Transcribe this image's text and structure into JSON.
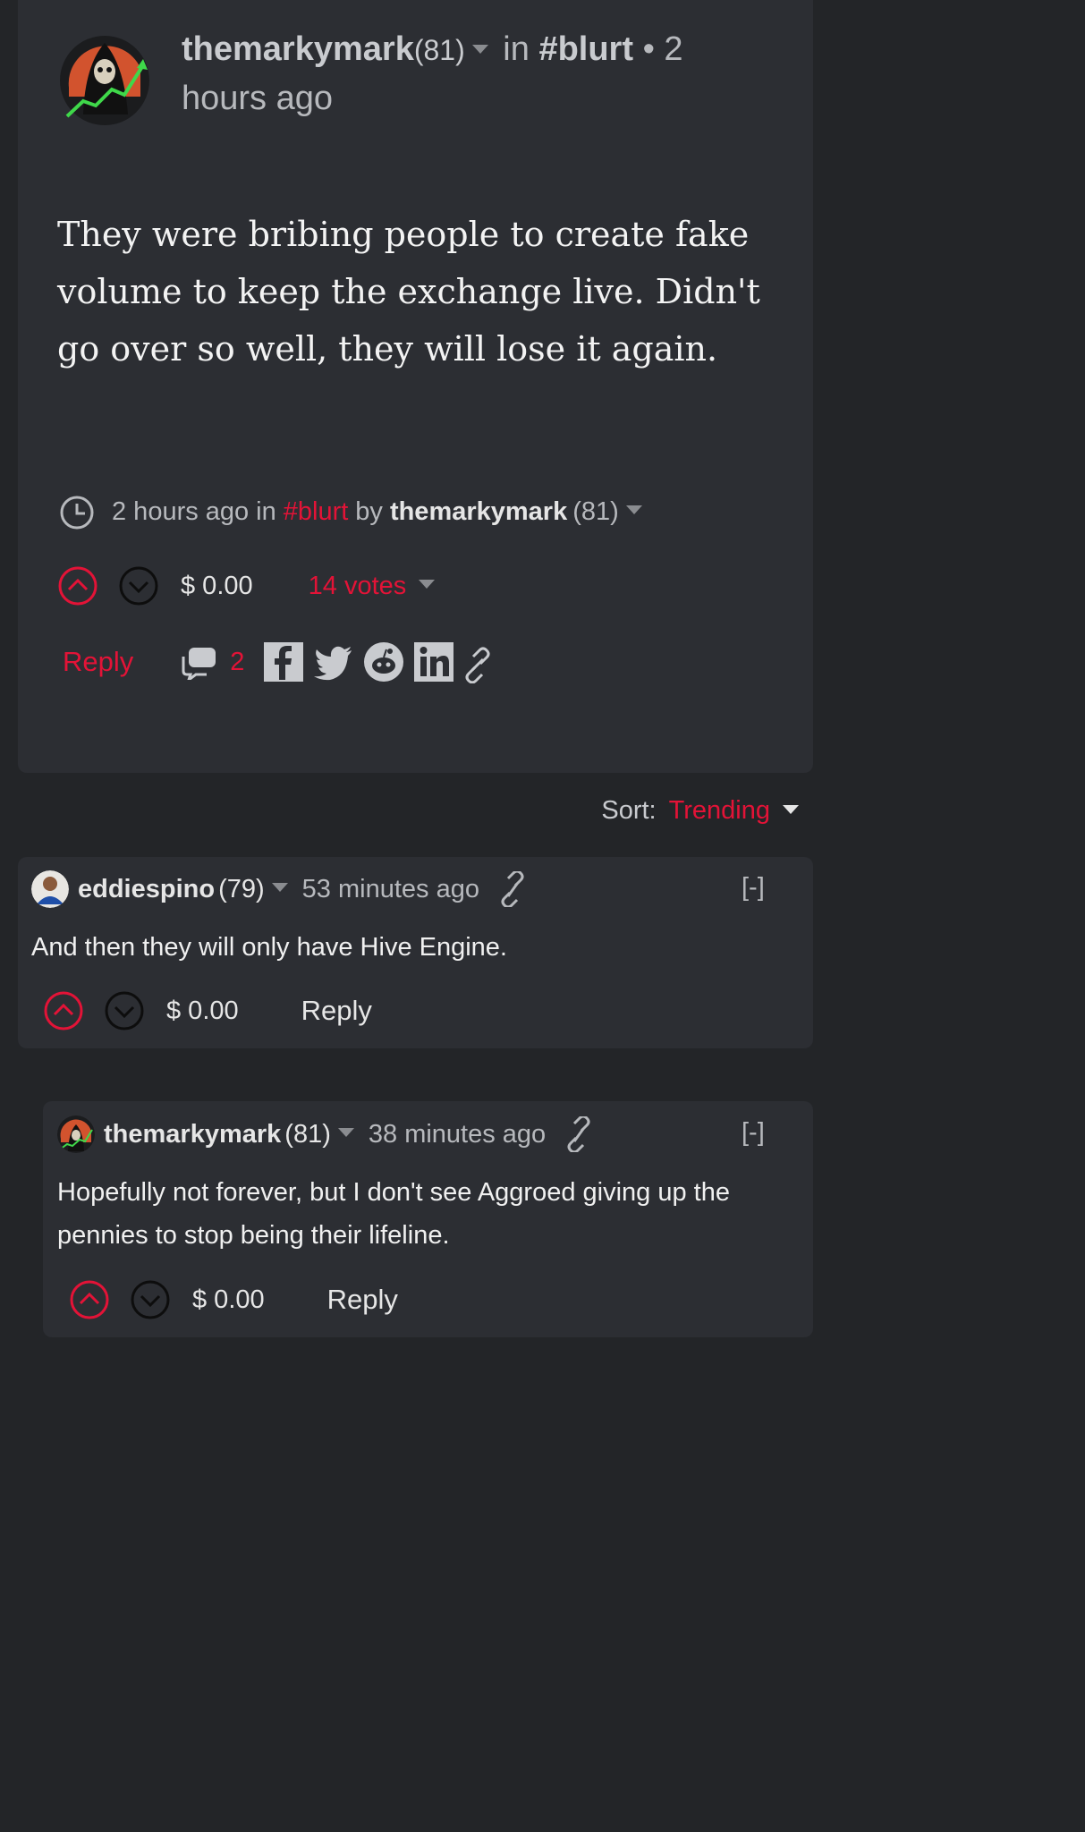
{
  "post": {
    "author": "themarkymark",
    "reputation": "(81)",
    "in_label": "in",
    "tag": "#blurt",
    "time_prefix": "• 2",
    "time_suffix": "hours ago",
    "body": "They were bribing people to create fake volume to keep the exchange live. Didn't go over so well, they will lose it again.",
    "meta": {
      "time": "2 hours ago",
      "in_label": "in",
      "tag": "#blurt",
      "by_label": "by",
      "author": "themarkymark",
      "reputation": "(81)"
    },
    "payout": "$ 0.00",
    "votes": "14 votes",
    "reply_label": "Reply",
    "comment_count": "2",
    "share_icons": [
      "facebook-icon",
      "twitter-icon",
      "reddit-icon",
      "linkedin-icon",
      "link-icon"
    ]
  },
  "sort": {
    "label": "Sort:",
    "value": "Trending"
  },
  "comments": [
    {
      "author": "eddiespino",
      "reputation": "(79)",
      "time": "53 minutes ago",
      "collapse": "[-]",
      "body": "And then they will only have Hive Engine.",
      "payout": "$ 0.00",
      "reply_label": "Reply"
    },
    {
      "author": "themarkymark",
      "reputation": "(81)",
      "time": "38 minutes ago",
      "collapse": "[-]",
      "body": "Hopefully not forever, but I don't see Aggroed giving up the pennies to stop being their lifeline.",
      "payout": "$ 0.00",
      "reply_label": "Reply"
    }
  ],
  "colors": {
    "accent": "#e31337",
    "background": "#232528",
    "card": "#2c2e33"
  }
}
